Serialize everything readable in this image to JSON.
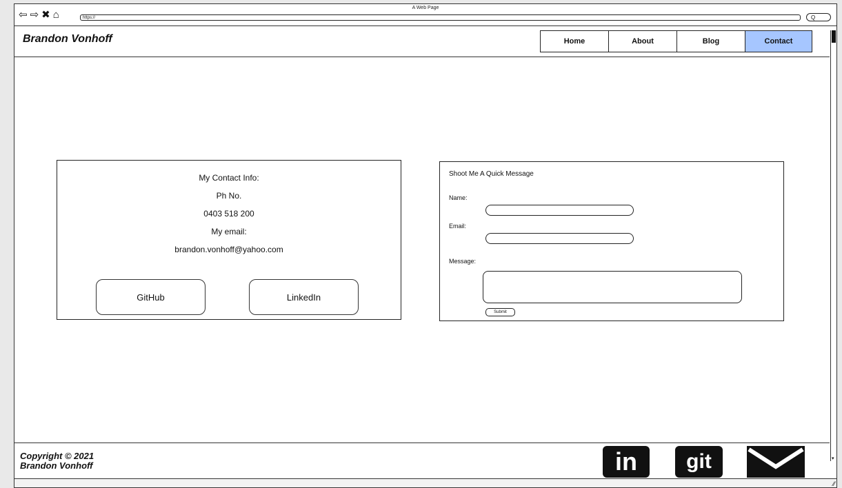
{
  "window": {
    "title": "A Web Page",
    "url": "https://",
    "search_glyph": "Q"
  },
  "header": {
    "brand": "Brandon Vonhoff"
  },
  "nav": {
    "home": "Home",
    "about": "About",
    "blog": "Blog",
    "contact": "Contact",
    "active": "Contact",
    "active_color": "#a6c6ff"
  },
  "contact_info": {
    "heading": "My Contact Info:",
    "phone_label": "Ph No.",
    "phone": "0403 518 200",
    "email_label": "My email:",
    "email": "brandon.vonhoff@yahoo.com",
    "github_label": "GitHub",
    "linkedin_label": "LinkedIn"
  },
  "message_form": {
    "title": "Shoot Me A Quick Message",
    "name_label": "Name:",
    "email_label": "Email:",
    "message_label": "Message:",
    "name_value": "",
    "email_value": "",
    "message_value": "",
    "submit_label": "Submit"
  },
  "footer": {
    "copyright_line1": "Copyright © 2021",
    "copyright_line2": "Brandon Vonhoff",
    "linkedin_text": "in",
    "git_text": "git"
  }
}
